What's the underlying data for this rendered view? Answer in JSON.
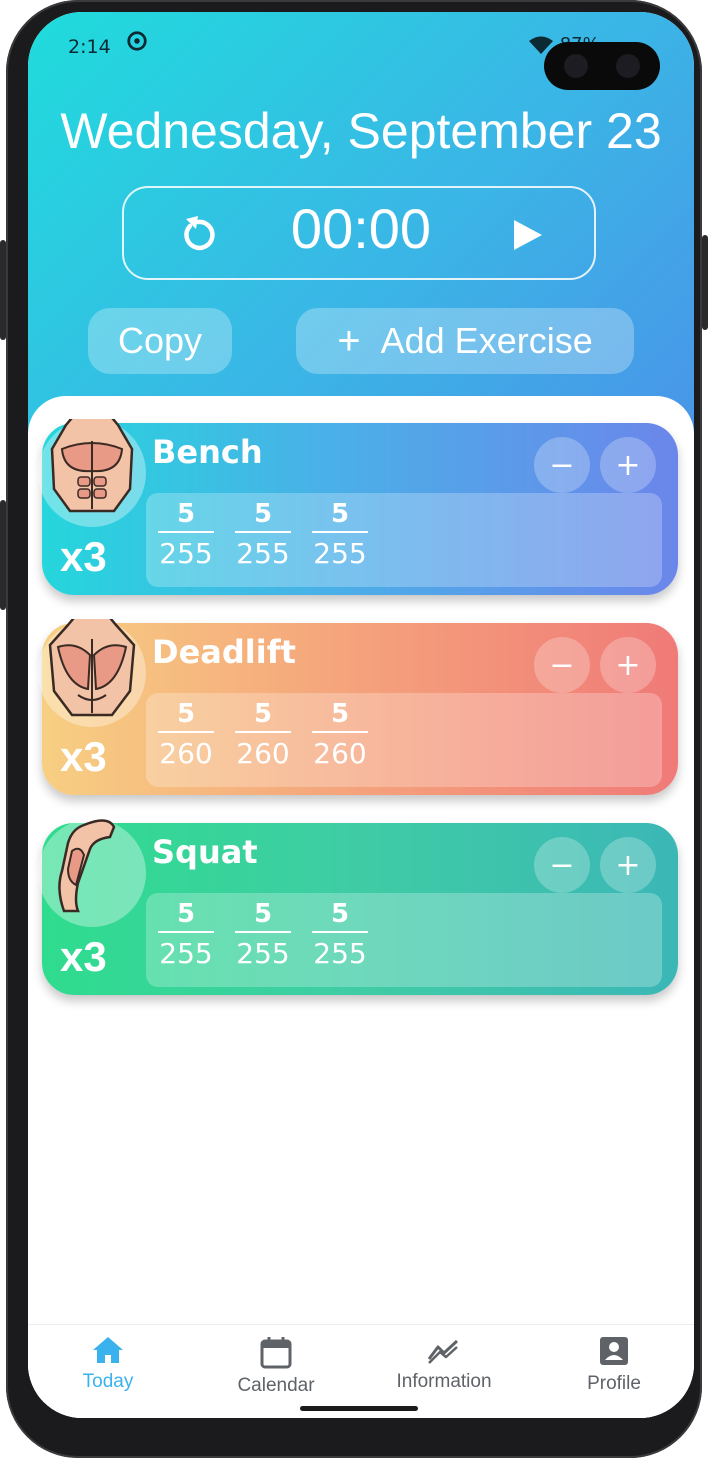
{
  "status_bar": {
    "time": "2:14",
    "battery_text": "87%"
  },
  "header": {
    "date": "Wednesday, September 23",
    "timer": "00:00",
    "copy_label": "Copy",
    "add_label": "Add Exercise"
  },
  "exercises": [
    {
      "name": "Bench",
      "count": "x3",
      "icon": "chest-muscle-icon",
      "sets": [
        {
          "reps": "5",
          "weight": "255"
        },
        {
          "reps": "5",
          "weight": "255"
        },
        {
          "reps": "5",
          "weight": "255"
        }
      ]
    },
    {
      "name": "Deadlift",
      "count": "x3",
      "icon": "back-muscle-icon",
      "sets": [
        {
          "reps": "5",
          "weight": "260"
        },
        {
          "reps": "5",
          "weight": "260"
        },
        {
          "reps": "5",
          "weight": "260"
        }
      ]
    },
    {
      "name": "Squat",
      "count": "x3",
      "icon": "leg-muscle-icon",
      "sets": [
        {
          "reps": "5",
          "weight": "255"
        },
        {
          "reps": "5",
          "weight": "255"
        },
        {
          "reps": "5",
          "weight": "255"
        }
      ]
    }
  ],
  "tabs": [
    {
      "label": "Today",
      "icon": "home-icon",
      "active": true
    },
    {
      "label": "Calendar",
      "icon": "calendar-icon",
      "active": false
    },
    {
      "label": "Information",
      "icon": "trending-icon",
      "active": false
    },
    {
      "label": "Profile",
      "icon": "profile-icon",
      "active": false
    }
  ],
  "colors": {
    "header_start": "#1fdcdc",
    "header_end": "#4a94e8",
    "tab_active": "#3ab2ee",
    "tab_inactive": "#5f6368"
  }
}
